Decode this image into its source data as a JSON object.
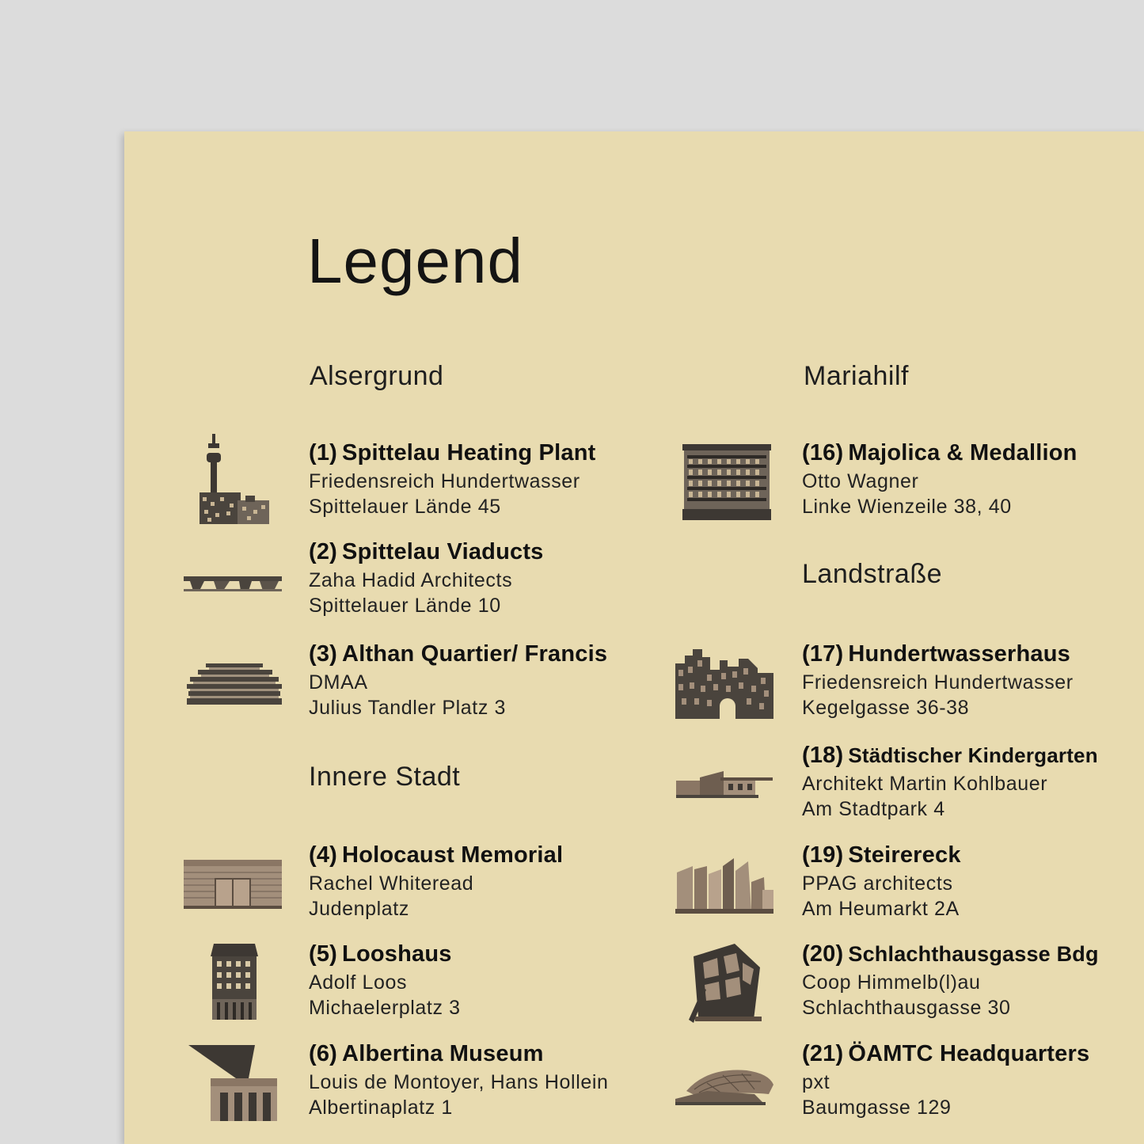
{
  "title": "Legend",
  "districts": {
    "alsergrund": "Alsergrund",
    "innere_stadt": "Innere Stadt",
    "mariahilf": "Mariahilf",
    "landstrasse": "Landstraße"
  },
  "entries": [
    {
      "num": "(1)",
      "name": "Spittelau Heating Plant",
      "architect": "Friedensreich Hundertwasser",
      "address": "Spittelauer Lände 45",
      "icon": "heating-plant-icon"
    },
    {
      "num": "(2)",
      "name": "Spittelau Viaducts",
      "architect": "Zaha Hadid Architects",
      "address": "Spittelauer Lände 10",
      "icon": "viaduct-icon"
    },
    {
      "num": "(3)",
      "name": "Althan Quartier/ Francis",
      "architect": "DMAA",
      "address": "Julius Tandler Platz 3",
      "icon": "stacked-building-icon"
    },
    {
      "num": "(4)",
      "name": "Holocaust Memorial",
      "architect": "Rachel Whiteread",
      "address": "Judenplatz",
      "icon": "memorial-icon"
    },
    {
      "num": "(5)",
      "name": "Looshaus",
      "architect": "Adolf Loos",
      "address": "Michaelerplatz 3",
      "icon": "looshaus-icon"
    },
    {
      "num": "(6)",
      "name": "Albertina Museum",
      "architect": "Louis de Montoyer, Hans Hollein",
      "address": "Albertinaplatz 1",
      "icon": "albertina-icon"
    },
    {
      "num": "(16)",
      "name": "Majolica & Medallion",
      "architect": "Otto Wagner",
      "address": "Linke Wienzeile 38, 40",
      "icon": "majolica-house-icon"
    },
    {
      "num": "(17)",
      "name": "Hundertwasserhaus",
      "architect": "Friedensreich Hundertwasser",
      "address": "Kegelgasse 36-38",
      "icon": "hundertwasserhaus-icon"
    },
    {
      "num": "(18)",
      "name": "Städtischer Kindergarten",
      "architect": "Architekt Martin Kohlbauer",
      "address": "Am Stadtpark 4",
      "icon": "kindergarten-icon"
    },
    {
      "num": "(19)",
      "name": "Steirereck",
      "architect": "PPAG architects",
      "address": "Am Heumarkt 2A",
      "icon": "steirereck-icon"
    },
    {
      "num": "(20)",
      "name": "Schlachthausgasse Bdg",
      "architect": "Coop Himmelb(l)au",
      "address": "Schlachthausgasse 30",
      "icon": "deconstructed-tower-icon"
    },
    {
      "num": "(21)",
      "name": "ÖAMTC Headquarters",
      "architect": "pxt",
      "address": "Baumgasse 129",
      "icon": "oeamtc-icon"
    }
  ]
}
